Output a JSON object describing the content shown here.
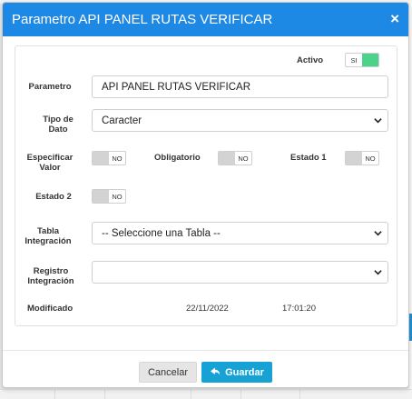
{
  "modal": {
    "title": "Parametro API PANEL RUTAS VERIFICAR",
    "close_icon": "×"
  },
  "form": {
    "activo": {
      "label": "Activo",
      "state": "SI",
      "on": true
    },
    "parametro": {
      "label": "Parametro",
      "value": "API PANEL RUTAS VERIFICAR"
    },
    "tipo_dato": {
      "label_line1": "Tipo de",
      "label_line2": "Dato",
      "value": "Caracter"
    },
    "especificar_valor": {
      "label_line1": "Especificar",
      "label_line2": "Valor",
      "state": "NO"
    },
    "obligatorio": {
      "label": "Obligatorio",
      "state": "NO"
    },
    "estado1": {
      "label": "Estado 1",
      "state": "NO"
    },
    "estado2": {
      "label": "Estado 2",
      "state": "NO"
    },
    "tabla_integracion": {
      "label_line1": "Tabla",
      "label_line2": "Integración",
      "value": "-- Seleccione una Tabla --"
    },
    "registro_integracion": {
      "label_line1": "Registro",
      "label_line2": "Integración",
      "value": ""
    },
    "modificado": {
      "label": "Modificado",
      "date": "22/11/2022",
      "time": "17:01:20"
    }
  },
  "footer": {
    "cancel_label": "Cancelar",
    "save_label": "Guardar"
  },
  "colors": {
    "header": "#1e88e5",
    "save_button": "#17a2d6",
    "toggle_on": "#4cd38a"
  }
}
